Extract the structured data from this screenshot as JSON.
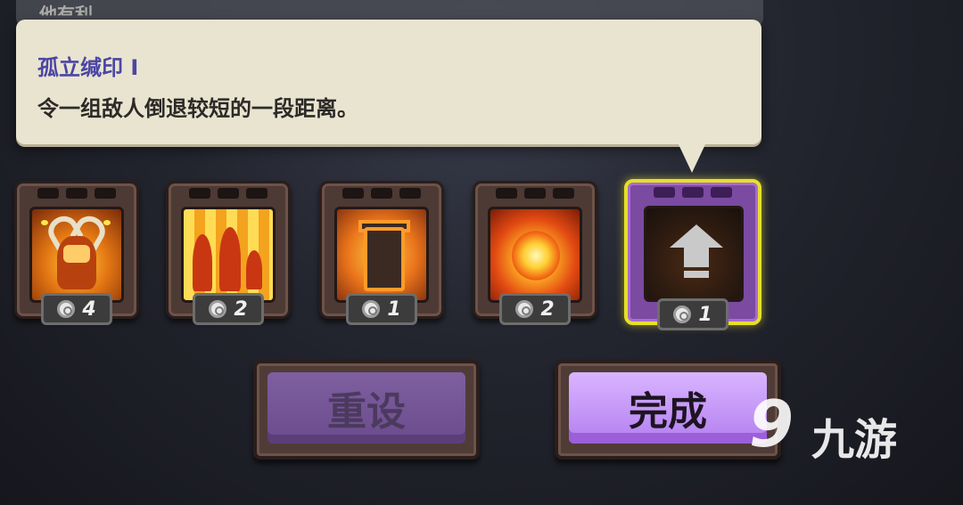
{
  "background": {
    "partial_text": "他有利。"
  },
  "tooltip": {
    "title": "孤立缄印 I",
    "description": "令一组敌人倒退较短的一段距离。"
  },
  "upgrades": [
    {
      "name": "demon",
      "cost": "4",
      "icon": "demon-icon",
      "selected": false
    },
    {
      "name": "lava",
      "cost": "2",
      "icon": "lava-icon",
      "selected": false
    },
    {
      "name": "tower",
      "cost": "1",
      "icon": "tower-icon",
      "selected": false
    },
    {
      "name": "fire",
      "cost": "2",
      "icon": "fireball-icon",
      "selected": false
    },
    {
      "name": "locked-upgrade",
      "cost": "1",
      "icon": "up-arrow-icon",
      "selected": true
    }
  ],
  "buttons": {
    "reset": "重设",
    "done": "完成"
  },
  "watermark": {
    "text": "九游",
    "mark": "9"
  },
  "colors": {
    "tooltip_title": "#4b46a4",
    "selected_border": "#e6df2a",
    "done_button": "#b37ff0",
    "reset_button": "#6a4b8c"
  }
}
